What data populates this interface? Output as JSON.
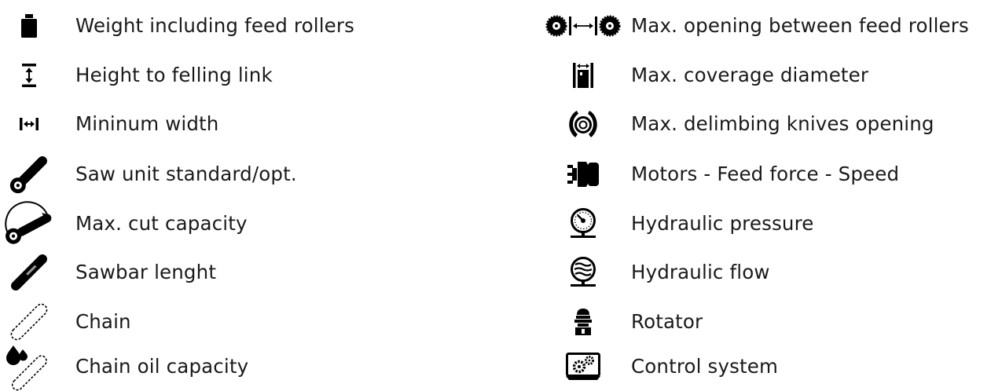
{
  "left_items": [
    {
      "label": "Weight including feed rollers",
      "icon": "weight-icon"
    },
    {
      "label": "Height to felling link",
      "icon": "height-icon"
    },
    {
      "label": "Mininum width",
      "icon": "width-icon"
    },
    {
      "label": "Saw unit standard/opt.",
      "icon": "saw-unit-icon"
    },
    {
      "label": "Max. cut capacity",
      "icon": "cut-capacity-icon"
    },
    {
      "label": "Sawbar lenght",
      "icon": "sawbar-icon"
    },
    {
      "label": "Chain",
      "icon": "chain-icon"
    },
    {
      "label": "Chain oil capacity",
      "icon": "chain-oil-icon"
    }
  ],
  "right_items": [
    {
      "label": "Max. opening between feed rollers",
      "icon": "feed-roller-opening-icon"
    },
    {
      "label": "Max. coverage diameter",
      "icon": "coverage-diameter-icon"
    },
    {
      "label": "Max. delimbing knives opening",
      "icon": "delimbing-knives-icon"
    },
    {
      "label": "Motors - Feed force - Speed",
      "icon": "motor-icon"
    },
    {
      "label": "Hydraulic pressure",
      "icon": "pressure-gauge-icon"
    },
    {
      "label": "Hydraulic flow",
      "icon": "hydraulic-flow-icon"
    },
    {
      "label": "Rotator",
      "icon": "rotator-icon"
    },
    {
      "label": "Control system",
      "icon": "control-system-icon"
    }
  ],
  "colors": {
    "text": "#1a1a1a",
    "icon": "#000000",
    "background": "#ffffff"
  }
}
